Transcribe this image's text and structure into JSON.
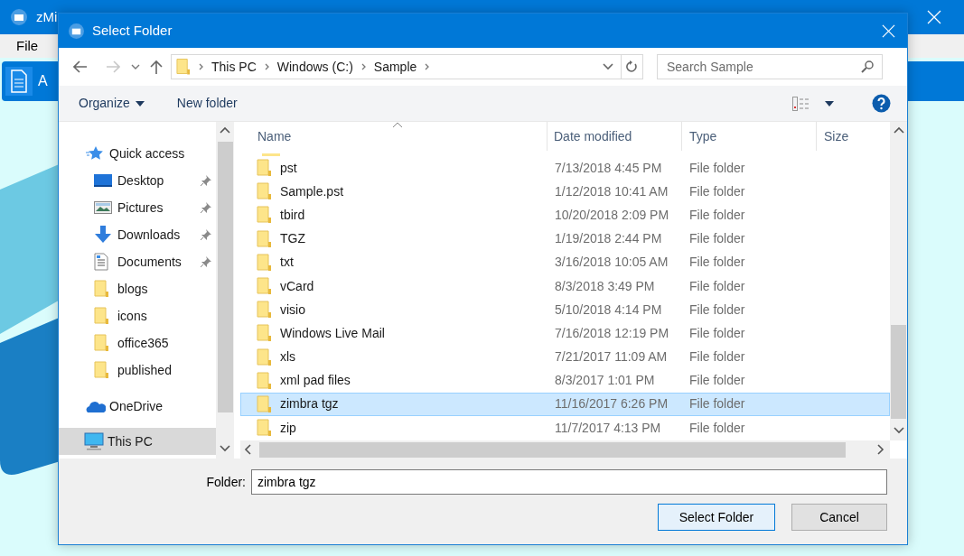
{
  "app": {
    "title": "zMi",
    "menu": [
      "File"
    ],
    "toolbar_item": "A"
  },
  "dialog": {
    "title": "Select Folder",
    "breadcrumb": [
      "This PC",
      "Windows (C:)",
      "Sample"
    ],
    "search": {
      "placeholder": "Search Sample"
    },
    "commands": [
      "Organize",
      "New folder"
    ],
    "sidebar": [
      {
        "label": "Quick access",
        "kind": "star",
        "selected": false,
        "children": [
          {
            "label": "Desktop",
            "kind": "desktop",
            "pinned": true,
            "selected": false
          },
          {
            "label": "Pictures",
            "kind": "pictures",
            "pinned": true,
            "selected": false
          },
          {
            "label": "Downloads",
            "kind": "downloads",
            "pinned": true,
            "selected": false
          },
          {
            "label": "Documents",
            "kind": "documents",
            "pinned": true,
            "selected": false
          },
          {
            "label": "blogs",
            "kind": "folder",
            "pinned": false,
            "selected": false
          },
          {
            "label": "icons",
            "kind": "folder",
            "pinned": false,
            "selected": false
          },
          {
            "label": "office365",
            "kind": "folder",
            "pinned": false,
            "selected": false
          },
          {
            "label": "published",
            "kind": "folder",
            "pinned": false,
            "selected": false
          }
        ]
      },
      {
        "label": "OneDrive",
        "kind": "cloud",
        "selected": false
      },
      {
        "label": "This PC",
        "kind": "pc",
        "selected": true
      }
    ],
    "table": {
      "columns": [
        "Name",
        "Date modified",
        "Type",
        "Size"
      ],
      "rows": [
        {
          "name": "pst",
          "date": "7/13/2018 4:45 PM",
          "type": "File folder",
          "selected": false
        },
        {
          "name": "Sample.pst",
          "date": "1/12/2018 10:41 AM",
          "type": "File folder",
          "selected": false
        },
        {
          "name": "tbird",
          "date": "10/20/2018 2:09 PM",
          "type": "File folder",
          "selected": false
        },
        {
          "name": "TGZ",
          "date": "1/19/2018 2:44 PM",
          "type": "File folder",
          "selected": false
        },
        {
          "name": "txt",
          "date": "3/16/2018 10:05 AM",
          "type": "File folder",
          "selected": false
        },
        {
          "name": "vCard",
          "date": "8/3/2018 3:49 PM",
          "type": "File folder",
          "selected": false
        },
        {
          "name": "visio",
          "date": "5/10/2018 4:14 PM",
          "type": "File folder",
          "selected": false
        },
        {
          "name": "Windows Live Mail",
          "date": "7/16/2018 12:19 PM",
          "type": "File folder",
          "selected": false
        },
        {
          "name": "xls",
          "date": "7/21/2017 11:09 AM",
          "type": "File folder",
          "selected": false
        },
        {
          "name": "xml pad files",
          "date": "8/3/2017 1:01 PM",
          "type": "File folder",
          "selected": false
        },
        {
          "name": "zimbra tgz",
          "date": "11/16/2017 6:26 PM",
          "type": "File folder",
          "selected": true
        },
        {
          "name": "zip",
          "date": "11/7/2017 4:13 PM",
          "type": "File folder",
          "selected": false
        }
      ]
    },
    "folder_field": {
      "label": "Folder:",
      "value": "zimbra tgz"
    },
    "buttons": [
      {
        "label": "Select Folder",
        "default": true
      },
      {
        "label": "Cancel",
        "default": false
      }
    ]
  }
}
